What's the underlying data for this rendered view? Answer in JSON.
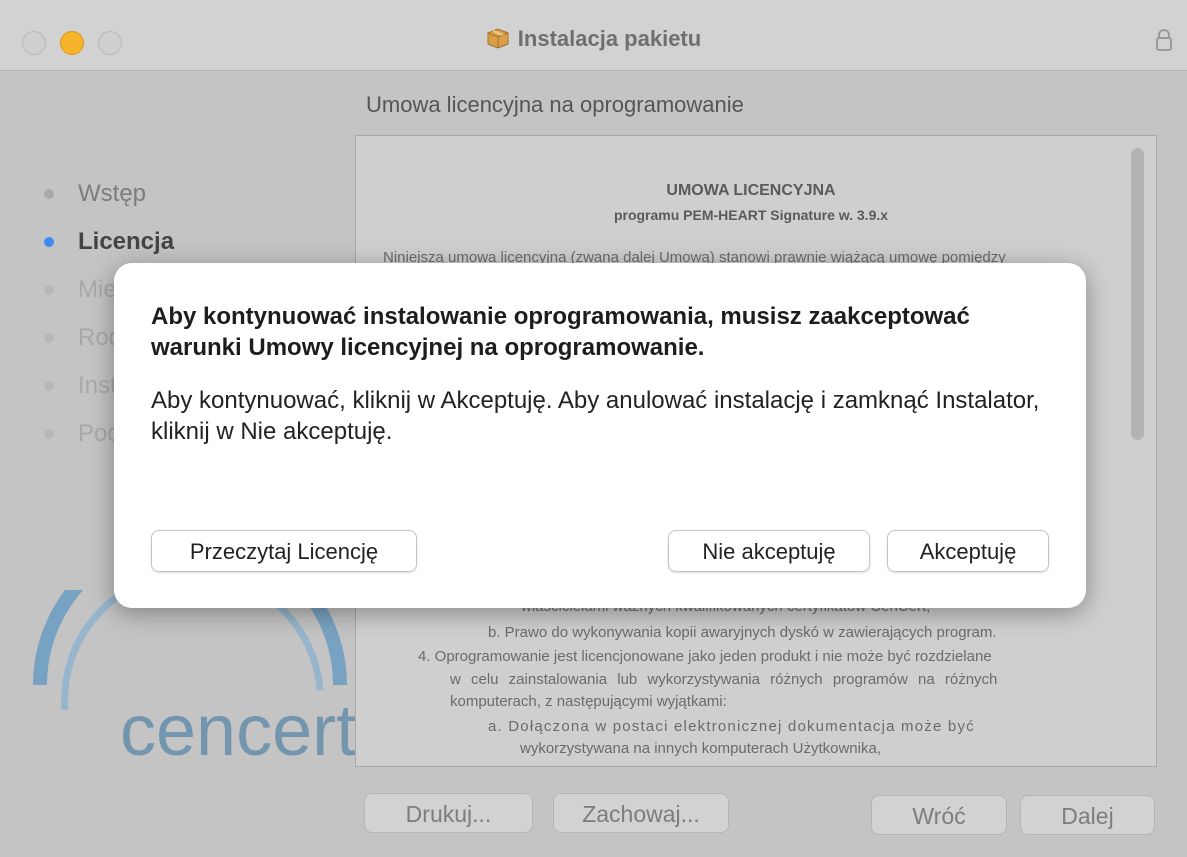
{
  "window": {
    "title": "Instalacja pakietu",
    "icons": {
      "package": "package-icon",
      "lock": "lock-icon"
    }
  },
  "main": {
    "heading": "Umowa licencyjna na oprogramowanie",
    "document": {
      "title": "UMOWA LICENCYJNA",
      "subtitle": "programu PEM-HEART Signature w. 3.9.x",
      "intro": "Niniejsza umowa licencyjna (zwana dalej Umową) stanowi prawnie wiążącą umowę pomiędzy",
      "lines": [
        "właścicielami ważnych kwalifikowanych certyfikatów CenCert,",
        "b.   Prawo do wykonywania kopii awaryjnych dyskó w zawierających program.",
        "4.   Oprogramowanie jest licencjonowane jako jeden produkt i nie może być rozdzielane",
        "w celu zainstalowania lub wykorzystywania różnych programów na różnych",
        "komputerach, z następującymi wyjątkami:",
        "a.   Dołączona w postaci elektronicznej dokumentacja może być",
        "wykorzystywana na innych komputerach Użytkownika,"
      ]
    }
  },
  "sidebar": {
    "steps": [
      {
        "label": "Wstęp",
        "state": "done"
      },
      {
        "label": "Licencja",
        "state": "active"
      },
      {
        "label": "Miejsce docelowe",
        "state": "pending"
      },
      {
        "label": "Rodzaj instalacji",
        "state": "pending"
      },
      {
        "label": "Instalacja",
        "state": "pending"
      },
      {
        "label": "Podsumowanie",
        "state": "pending"
      }
    ],
    "logo_text": "cencert"
  },
  "footer": {
    "print": "Drukuj...",
    "save": "Zachowaj...",
    "back": "Wróć",
    "next": "Dalej"
  },
  "dialog": {
    "title": "Aby kontynuować instalowanie oprogramowania, musisz zaakceptować warunki Umowy licencyjnej na oprogramowanie.",
    "message": "Aby kontynuować, kliknij w Akceptuję. Aby anulować instalację i zamknąć Instalator, kliknij w Nie akceptuję.",
    "read_license": "Przeczytaj Licencję",
    "decline": "Nie akceptuję",
    "accept": "Akceptuję"
  },
  "colors": {
    "accent": "#3f8af0",
    "minimize": "#f6b42b"
  }
}
